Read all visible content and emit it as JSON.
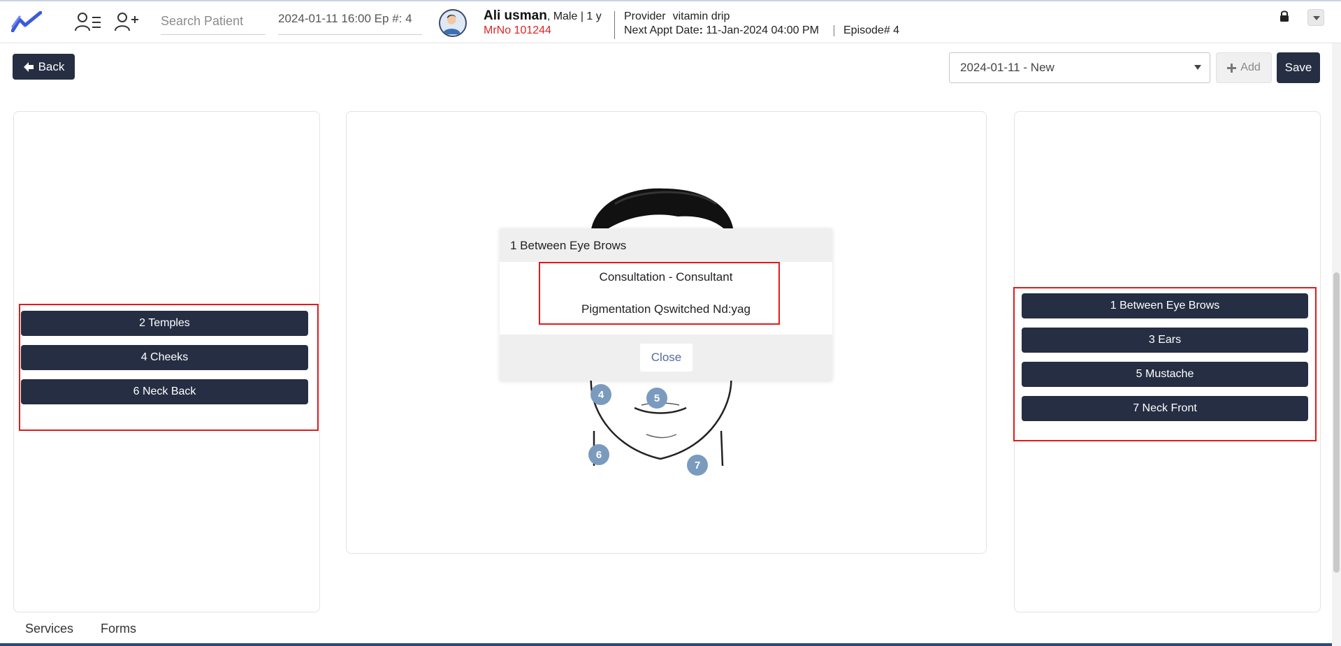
{
  "header": {
    "search": {
      "placeholder": "Search Patient",
      "value": ""
    },
    "episode_selector": "2024-01-11 16:00 Ep #: 4",
    "patient": {
      "name": "Ali usman",
      "meta": ", Male | 1 y",
      "mrno": "MrNo 101244"
    },
    "provider_label": "Provider",
    "provider_value": "vitamin drip",
    "next_appt_label": "Next Appt Date",
    "next_appt_value": " 11-Jan-2024 04:00 PM",
    "episode_number": "Episode# 4"
  },
  "toolbar": {
    "back_label": "Back",
    "visit_value": "2024-01-11 - New",
    "add_label": "Add",
    "save_label": "Save"
  },
  "left_regions": [
    {
      "label": "2 Temples"
    },
    {
      "label": "4 Cheeks"
    },
    {
      "label": "6 Neck Back"
    }
  ],
  "right_regions": [
    {
      "label": "1 Between Eye Brows"
    },
    {
      "label": "3 Ears"
    },
    {
      "label": "5 Mustache"
    },
    {
      "label": "7 Neck Front"
    }
  ],
  "face_markers": [
    "4",
    "5",
    "6",
    "7"
  ],
  "popup": {
    "title": "1 Between Eye Brows",
    "items": [
      "Consultation - Consultant",
      "Pigmentation Qswitched Nd:yag"
    ],
    "close_label": "Close"
  },
  "bottom_tabs": [
    "Services",
    "Forms"
  ],
  "colors": {
    "primary_button": "#252e42",
    "highlight": "#e01b1b",
    "mrno_text": "#e02424",
    "marker": "#7a9bbd",
    "logo": "#3a5bd9"
  }
}
